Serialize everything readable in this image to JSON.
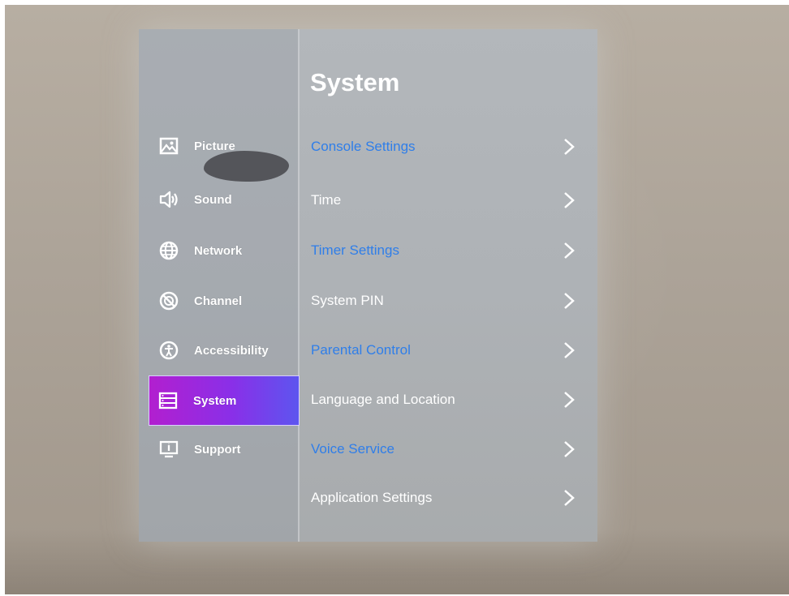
{
  "page_title": "System",
  "sidebar": {
    "items": [
      {
        "label": "Picture",
        "icon": "picture-icon"
      },
      {
        "label": "Sound",
        "icon": "speaker-icon"
      },
      {
        "label": "Network",
        "icon": "globe-icon"
      },
      {
        "label": "Channel",
        "icon": "channel-icon"
      },
      {
        "label": "Accessibility",
        "icon": "accessibility-icon"
      },
      {
        "label": "System",
        "icon": "list-icon",
        "selected": true
      },
      {
        "label": "Support",
        "icon": "info-screen-icon"
      }
    ]
  },
  "menu": {
    "items": [
      {
        "label": "Console Settings",
        "color": "#2f7ee9"
      },
      {
        "label": "Time",
        "color": "#ffffff"
      },
      {
        "label": "Timer Settings",
        "color": "#2f7ee9"
      },
      {
        "label": "System PIN",
        "color": "#ffffff"
      },
      {
        "label": "Parental Control",
        "color": "#2f7ee9"
      },
      {
        "label": "Language and Location",
        "color": "#ffffff"
      },
      {
        "label": "Voice Service",
        "color": "#2f7ee9"
      },
      {
        "label": "Application Settings",
        "color": "#ffffff"
      }
    ]
  },
  "colors": {
    "accent_blue": "#2f7ee9",
    "selected_gradient_start": "#b21fcf",
    "selected_gradient_end": "#5d55ef"
  }
}
